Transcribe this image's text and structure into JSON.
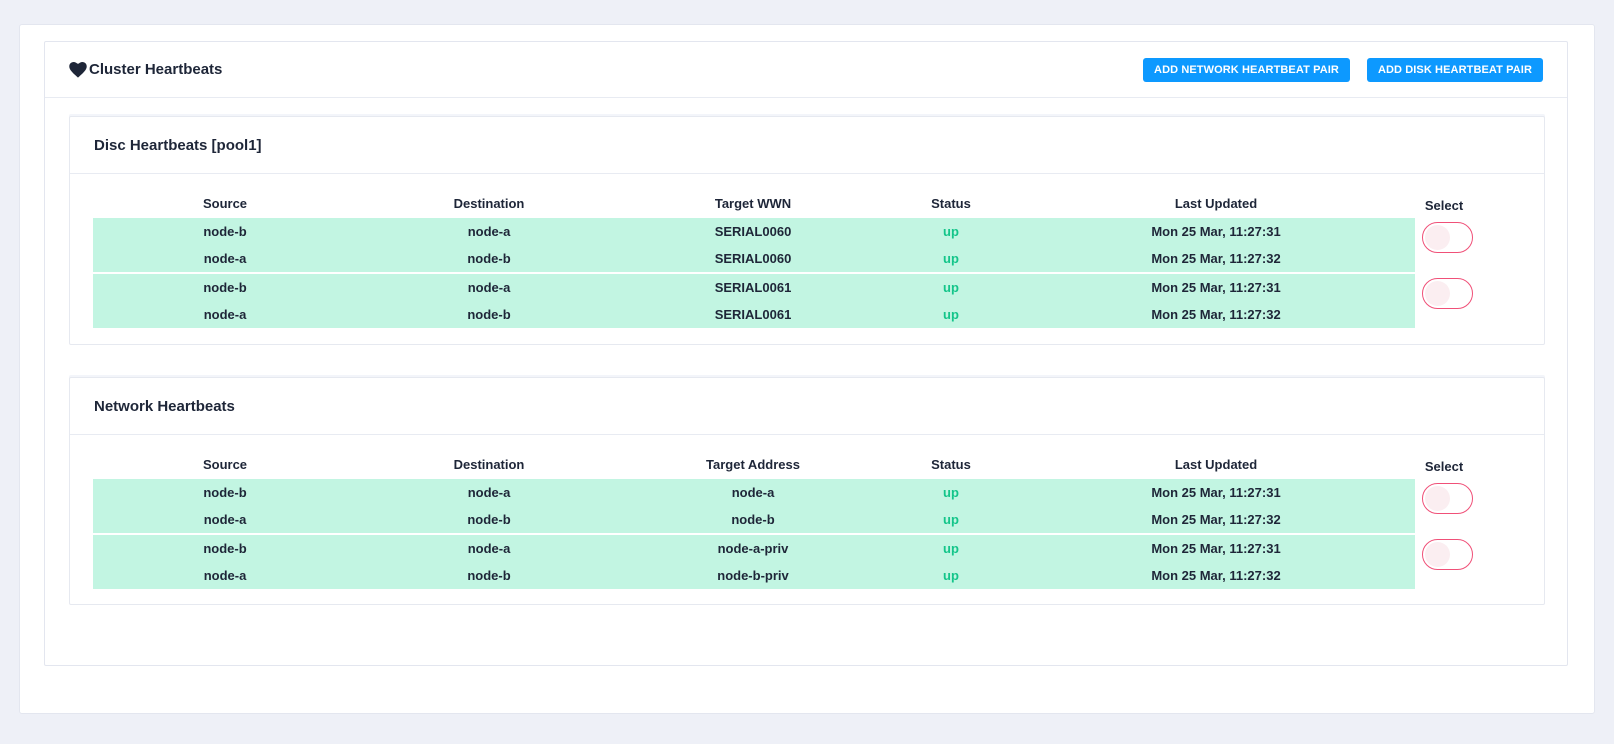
{
  "panel": {
    "title": "Cluster Heartbeats",
    "buttons": {
      "add_network": "ADD NETWORK HEARTBEAT PAIR",
      "add_disk": "ADD DISK HEARTBEAT PAIR"
    }
  },
  "disk": {
    "title": "Disc Heartbeats [pool1]",
    "columns": [
      "Source",
      "Destination",
      "Target WWN",
      "Status",
      "Last Updated"
    ],
    "select_label": "Select",
    "groups": [
      {
        "rows": [
          [
            "node-b",
            "node-a",
            "SERIAL0060",
            "up",
            "Mon 25 Mar, 11:27:31"
          ],
          [
            "node-a",
            "node-b",
            "SERIAL0060",
            "up",
            "Mon 25 Mar, 11:27:32"
          ]
        ]
      },
      {
        "rows": [
          [
            "node-b",
            "node-a",
            "SERIAL0061",
            "up",
            "Mon 25 Mar, 11:27:31"
          ],
          [
            "node-a",
            "node-b",
            "SERIAL0061",
            "up",
            "Mon 25 Mar, 11:27:32"
          ]
        ]
      }
    ]
  },
  "network": {
    "title": "Network Heartbeats",
    "columns": [
      "Source",
      "Destination",
      "Target Address",
      "Status",
      "Last Updated"
    ],
    "select_label": "Select",
    "groups": [
      {
        "rows": [
          [
            "node-b",
            "node-a",
            "node-a",
            "up",
            "Mon 25 Mar, 11:27:31"
          ],
          [
            "node-a",
            "node-b",
            "node-b",
            "up",
            "Mon 25 Mar, 11:27:32"
          ]
        ]
      },
      {
        "rows": [
          [
            "node-b",
            "node-a",
            "node-a-priv",
            "up",
            "Mon 25 Mar, 11:27:31"
          ],
          [
            "node-a",
            "node-b",
            "node-b-priv",
            "up",
            "Mon 25 Mar, 11:27:32"
          ]
        ]
      }
    ]
  },
  "colors": {
    "accent": "#0d99ff",
    "row_bg": "#c2f5e2",
    "status_up": "#14c58a",
    "toggle_border": "#f05078"
  }
}
